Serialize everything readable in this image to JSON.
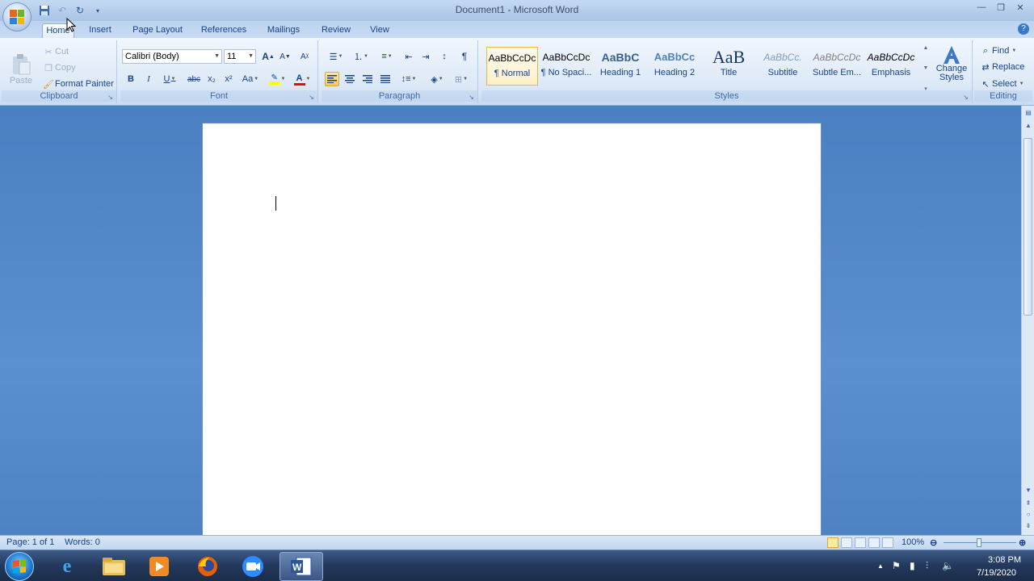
{
  "window": {
    "title": "Document1 - Microsoft Word",
    "controls": [
      "minimize",
      "maximize",
      "close"
    ]
  },
  "tabs": [
    {
      "label": "Home",
      "active": true
    },
    {
      "label": "Insert"
    },
    {
      "label": "Page Layout"
    },
    {
      "label": "References"
    },
    {
      "label": "Mailings"
    },
    {
      "label": "Review"
    },
    {
      "label": "View"
    }
  ],
  "clipboard": {
    "paste": "Paste",
    "cut": "Cut",
    "copy": "Copy",
    "format_painter": "Format Painter",
    "label": "Clipboard"
  },
  "font": {
    "family": "Calibri (Body)",
    "size": "11",
    "label": "Font",
    "bold": "B",
    "italic": "I",
    "underline": "U",
    "strike": "abc",
    "subscript": "x₂",
    "superscript": "x²",
    "change_case": "Aa",
    "grow": "A",
    "shrink": "A",
    "highlight_color": "#ffff00",
    "font_color": "#ff0000"
  },
  "paragraph": {
    "label": "Paragraph",
    "pilcrow": "¶"
  },
  "styles": {
    "label": "Styles",
    "items": [
      {
        "sample": "AaBbCcDc",
        "name": "¶ Normal",
        "selected": true
      },
      {
        "sample": "AaBbCcDc",
        "name": "¶ No Spaci..."
      },
      {
        "sample": "AaBbC",
        "name": "Heading 1"
      },
      {
        "sample": "AaBbCc",
        "name": "Heading 2"
      },
      {
        "sample": "AaB",
        "name": "Title"
      },
      {
        "sample": "AaBbCc.",
        "name": "Subtitle"
      },
      {
        "sample": "AaBbCcDc",
        "name": "Subtle Em..."
      },
      {
        "sample": "AaBbCcDc",
        "name": "Emphasis"
      }
    ],
    "change_styles_line1": "Change",
    "change_styles_line2": "Styles"
  },
  "editing": {
    "label": "Editing",
    "find": "Find",
    "replace": "Replace",
    "select": "Select"
  },
  "status": {
    "page": "Page: 1 of 1",
    "words": "Words: 0",
    "zoom": "100%",
    "zoom_percent": 100
  },
  "taskbar": {
    "time": "3:08 PM",
    "date": "7/19/2020",
    "apps": [
      "internet-explorer",
      "file-explorer",
      "media-player",
      "firefox",
      "zoom",
      "microsoft-word"
    ]
  }
}
